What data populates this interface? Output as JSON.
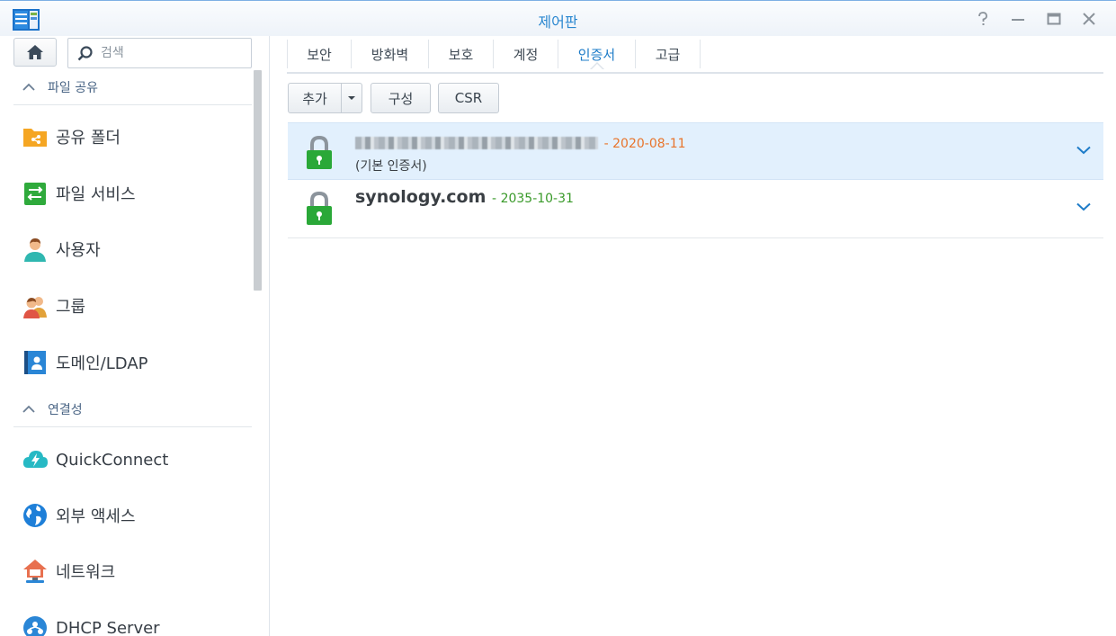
{
  "window": {
    "title": "제어판"
  },
  "sidebar": {
    "search_placeholder": "검색",
    "sections": [
      {
        "label": "파일 공유",
        "items": [
          {
            "label": "공유 폴더",
            "icon": "shared-folder-icon"
          },
          {
            "label": "파일 서비스",
            "icon": "file-services-icon"
          },
          {
            "label": "사용자",
            "icon": "user-icon"
          },
          {
            "label": "그룹",
            "icon": "group-icon"
          },
          {
            "label": "도메인/LDAP",
            "icon": "domain-ldap-icon"
          }
        ]
      },
      {
        "label": "연결성",
        "items": [
          {
            "label": "QuickConnect",
            "icon": "quickconnect-icon"
          },
          {
            "label": "외부 액세스",
            "icon": "external-access-icon"
          },
          {
            "label": "네트워크",
            "icon": "network-icon"
          },
          {
            "label": "DHCP Server",
            "icon": "dhcp-server-icon"
          }
        ]
      }
    ]
  },
  "tabs": [
    {
      "label": "보안"
    },
    {
      "label": "방화벽"
    },
    {
      "label": "보호"
    },
    {
      "label": "계정"
    },
    {
      "label": "인증서",
      "active": true
    },
    {
      "label": "고급"
    }
  ],
  "toolbar": {
    "add_label": "추가",
    "configure_label": "구성",
    "csr_label": "CSR"
  },
  "certificates": [
    {
      "name": "",
      "date": "2020-08-11",
      "note": "(기본 인증서)",
      "date_color": "#e8742b",
      "selected": true
    },
    {
      "name": "synology.com",
      "date": "2035-10-31",
      "note": "",
      "date_color": "#3a9a2a",
      "selected": false
    }
  ],
  "colors": {
    "accent": "#1e7cc8",
    "lock_green": "#2aa838",
    "selected_row": "#e2f0fd"
  }
}
